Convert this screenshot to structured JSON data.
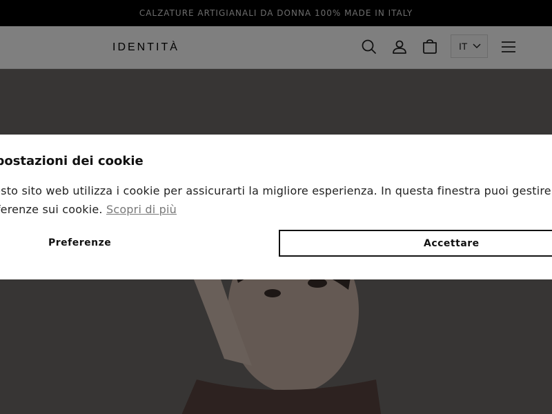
{
  "announcement": "CALZATURE ARTIGIANALI DA DONNA 100% MADE IN ITALY",
  "header": {
    "logo": "IDENTITÀ",
    "language": "IT",
    "icons": [
      "search-icon",
      "account-icon",
      "cart-icon",
      "chevron-down-icon",
      "menu-icon"
    ]
  },
  "cookie": {
    "title": "Impostazioni dei cookie",
    "text": "Questo sito web utilizza i cookie per assicurarti la migliore esperienza. In questa finestra puoi gestire le tue preferenze sui cookie.",
    "link": "Scopri di più",
    "prefs_label": "Preferenze",
    "accept_label": "Accettare"
  },
  "colors": {
    "announcement_bg": "#000000",
    "overlay": "rgba(0,0,0,0.5)",
    "accent": "#111111"
  }
}
